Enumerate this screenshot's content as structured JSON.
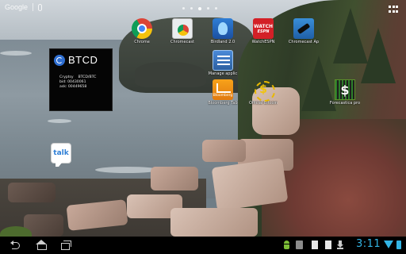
{
  "search": {
    "logo_text": "Google",
    "logo_icon": "google-wordmark",
    "mic_icon": "mic-icon"
  },
  "home_pages": {
    "count": 5,
    "current": 3
  },
  "all_apps": {
    "icon": "apps-grid-icon"
  },
  "widget": {
    "title": "BTCD",
    "logo_icon": "btcd-logo-icon",
    "line1": "Cryptsy    BTCD/BTC",
    "line2": "bid: 00430061",
    "line3": "ask: 00449658"
  },
  "apps": {
    "chrome": "Chrome",
    "chromecast_app": "Chromecast",
    "birdland": "Birdland 2.0",
    "watchespn": "WatchESPN",
    "watchespn_icon_top": "WATCH",
    "watchespn_icon_bottom": "ESPN",
    "chromecast_ap": "Chromecast Ap",
    "manage": "Manage applic",
    "bloomberg": "Bloomberg Tab",
    "bloomberg_icon_text": "Bloomberg",
    "bitcoin": "Official Bitcoin",
    "forecastica": "Forecastica pro",
    "forecastica_icon_text": "$",
    "talk_icon_text": "talk"
  },
  "system_bar": {
    "time": "3:11",
    "accent_color": "#33b5e5",
    "status_icons": [
      "android-icon",
      "store-icon",
      "document-icon",
      "document-icon",
      "download-icon",
      "wifi-icon",
      "battery-icon"
    ]
  }
}
